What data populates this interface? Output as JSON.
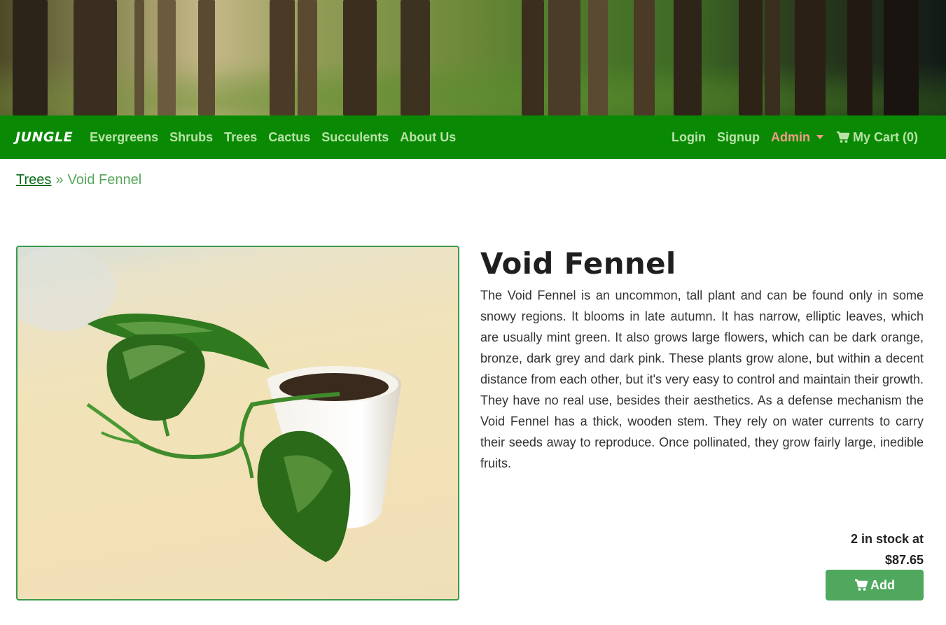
{
  "nav": {
    "brand": "JUNGLE",
    "links": [
      "Evergreens",
      "Shrubs",
      "Trees",
      "Cactus",
      "Succulents",
      "About Us"
    ],
    "login": "Login",
    "signup": "Signup",
    "admin": "Admin",
    "cart": "My Cart (0)",
    "cart_icon": "cart-icon",
    "caret_icon": "chevron-down-icon"
  },
  "breadcrumb": {
    "category": "Trees",
    "separator": "»",
    "current": "Void Fennel"
  },
  "product": {
    "name": "Void Fennel",
    "description": "The Void Fennel is an uncommon, tall plant and can be found only in some snowy regions. It blooms in late autumn. It has narrow, elliptic leaves, which are usually mint green. It also grows large flowers, which can be dark orange, bronze, dark grey and dark pink. These plants grow alone, but within a decent distance from each other, but it's very easy to control and maintain their growth. They have no real use, besides their aesthetics. As a defense mechanism the Void Fennel has a thick, wooden stem. They rely on water currents to carry their seeds away to reproduce. Once pollinated, they grow fairly large, inedible fruits.",
    "stock_line": "2 in stock at",
    "price": "$87.65",
    "add_label": "Add"
  },
  "colors": {
    "nav_bg": "#0a8a04",
    "nav_link": "#b9e2a8",
    "admin": "#f59a8a",
    "button": "#4fa85e"
  }
}
